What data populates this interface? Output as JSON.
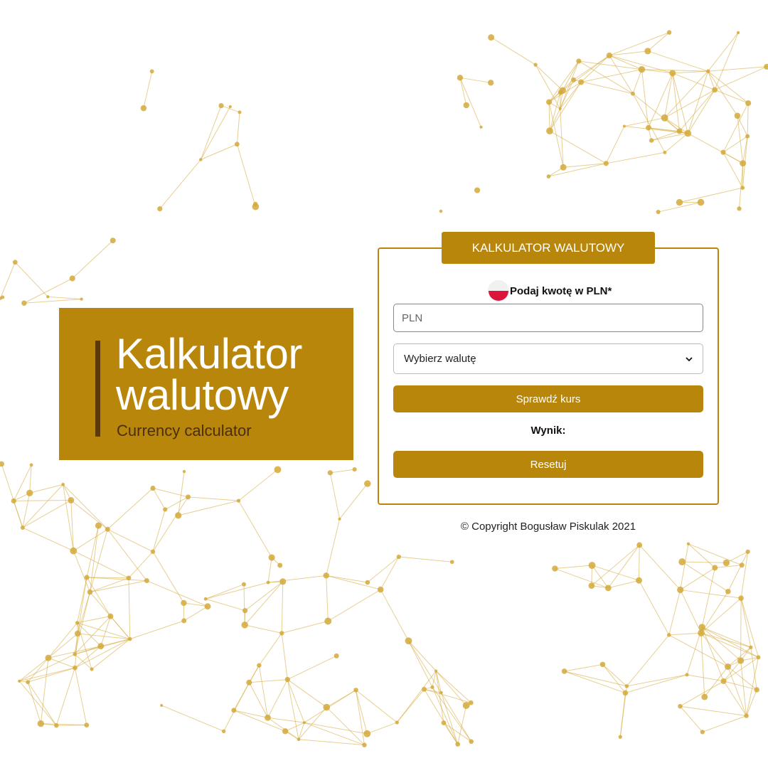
{
  "colors": {
    "accent": "#b8860b",
    "accent_dark": "#5b3a08",
    "network": "#d4a93a"
  },
  "hero": {
    "title_line1": "Kalkulator",
    "title_line2": "walutowy",
    "subtitle": "Currency calculator"
  },
  "form": {
    "header": "KALKULATOR WALUTOWY",
    "flag_icon": "poland-flag-icon",
    "amount_label": "Podaj kwotę w PLN*",
    "amount_placeholder": "PLN",
    "amount_value": "",
    "currency_selected": "Wybierz walutę",
    "check_button": "Sprawdź kurs",
    "result_label": "Wynik:",
    "reset_button": "Resetuj"
  },
  "footer": {
    "copyright": "© Copyright Bogusław Piskulak 2021"
  }
}
